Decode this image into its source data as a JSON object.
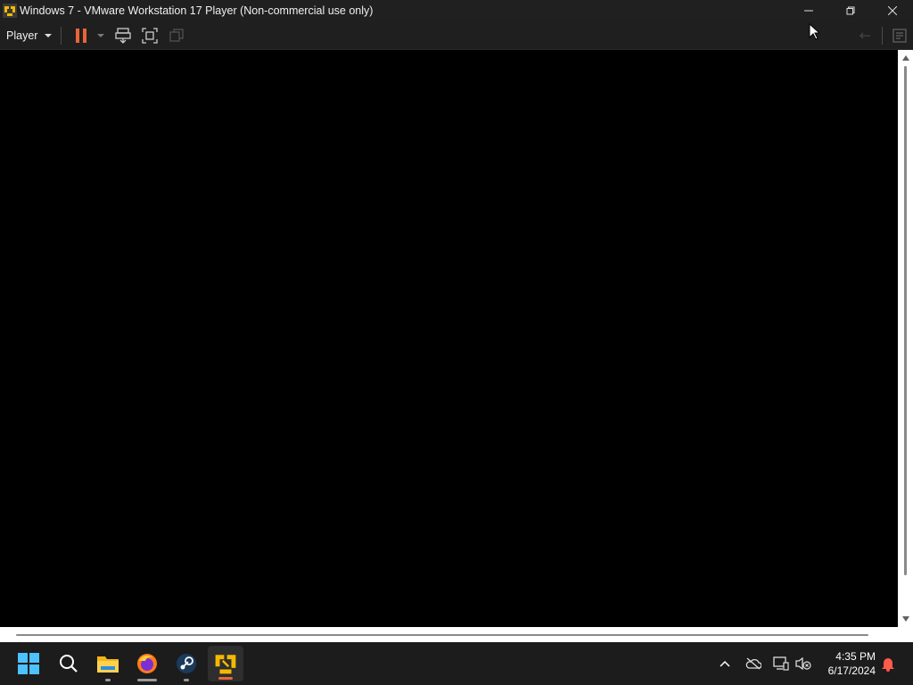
{
  "window": {
    "title": "Windows 7 - VMware Workstation 17 Player (Non-commercial use only)",
    "icon": "vmware-player-icon",
    "controls": [
      "minimize-icon",
      "restore-icon",
      "close-icon"
    ]
  },
  "toolbar": {
    "player_menu_label": "Player",
    "buttons": [
      "pause-icon",
      "dropdown-icon",
      "send-ctrl-alt-del-icon",
      "full-screen-icon",
      "unity-icon"
    ],
    "right_buttons": [
      "back-arrow-icon",
      "message-log-icon"
    ]
  },
  "vm_screen": {
    "state": "black"
  },
  "taskbar": {
    "apps": [
      {
        "name": "start-button",
        "icon": "windows-icon"
      },
      {
        "name": "search-button",
        "icon": "search-icon"
      },
      {
        "name": "file-explorer",
        "icon": "folder-icon"
      },
      {
        "name": "firefox",
        "icon": "firefox-icon"
      },
      {
        "name": "steam",
        "icon": "steam-icon"
      },
      {
        "name": "vmware-player",
        "icon": "vmware-player-icon"
      }
    ],
    "tray": [
      "chevron-up-icon",
      "onedrive-offline-icon",
      "network-icon",
      "volume-muted-icon"
    ],
    "clock": {
      "time": "4:35 PM",
      "date": "6/17/2024"
    },
    "notification_icon": "bell-icon"
  },
  "colors": {
    "accent_orange": "#e8643a",
    "titlebar": "#202020",
    "taskbar": "#1c1c1c"
  }
}
